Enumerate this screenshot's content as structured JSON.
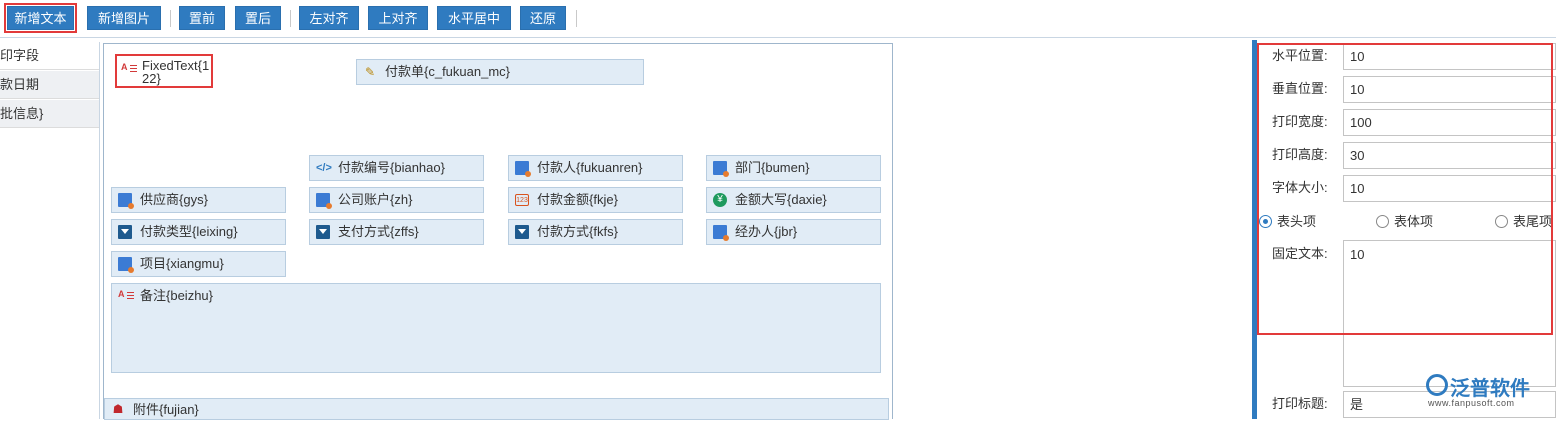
{
  "toolbar": {
    "buttons": [
      "新增文本",
      "新增图片",
      "置前",
      "置后",
      "左对齐",
      "上对齐",
      "水平居中",
      "还原"
    ]
  },
  "left_list": {
    "items": [
      "打印字段",
      "付款日期",
      "审批信息}"
    ]
  },
  "canvas": {
    "fixed_text": "FixedText{122}",
    "title_field": "付款单{c_fukuan_mc}",
    "fields": {
      "bianhao": "付款编号{bianhao}",
      "fukuanren": "付款人{fukuanren}",
      "bumen": "部门{bumen}",
      "gys": "供应商{gys}",
      "zh": "公司账户{zh}",
      "fkje": "付款金额{fkje}",
      "daxie": "金额大写{daxie}",
      "leixing": "付款类型{leixing}",
      "zffs": "支付方式{zffs}",
      "fkfs": "付款方式{fkfs}",
      "jbr": "经办人{jbr}",
      "xiangmu": "项目{xiangmu}"
    },
    "remark_field": "备注{beizhu}",
    "attachment_field": "附件{fujian}"
  },
  "properties": {
    "h_pos_label": "水平位置:",
    "h_pos_value": "10",
    "v_pos_label": "垂直位置:",
    "v_pos_value": "10",
    "width_label": "打印宽度:",
    "width_value": "100",
    "height_label": "打印高度:",
    "height_value": "30",
    "font_size_label": "字体大小:",
    "font_size_value": "10",
    "radios": [
      {
        "label": "表头项",
        "checked": true
      },
      {
        "label": "表体项",
        "checked": false
      },
      {
        "label": "表尾项",
        "checked": false
      }
    ],
    "fixed_text_label": "固定文本:",
    "fixed_text_value": "10",
    "print_title_label": "打印标题:",
    "print_title_value": "是"
  },
  "watermark": {
    "name": "泛普软件",
    "url": "www.fanpusoft.com"
  },
  "colors": {
    "accent": "#2f7bc0",
    "highlight": "#e23a3a",
    "field_bg": "#e1ecf6"
  }
}
